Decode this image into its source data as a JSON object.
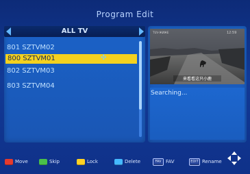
{
  "screen": {
    "title": "Program Edit"
  },
  "list": {
    "header": "ALL TV",
    "channels": [
      {
        "label": "801 SZTVM02",
        "selected": false
      },
      {
        "label": "800 SZTVM01",
        "selected": true
      },
      {
        "label": "802 SZTVM03",
        "selected": false
      },
      {
        "label": "803 SZTVM04",
        "selected": false
      }
    ]
  },
  "preview": {
    "osd_left": "TUV-ЖИЖЕ",
    "osd_right": "12:59",
    "subtitle": "来看看这只小鹿"
  },
  "info": {
    "status": "Searching..."
  },
  "help": [
    {
      "label": "Move",
      "color": "#e53a2d",
      "icon": "red-key"
    },
    {
      "label": "Skip",
      "color": "#4ac04a",
      "icon": "green-key"
    },
    {
      "label": "Lock",
      "color": "#ffd223",
      "icon": "yellow-key"
    },
    {
      "label": "Delete",
      "color": "#45b9ff",
      "icon": "blue-key"
    },
    {
      "label": "FAV",
      "key_text": "FAV",
      "icon": "fav-key"
    },
    {
      "label": "Rename",
      "key_text": "EDIT",
      "icon": "edit-key"
    }
  ],
  "theme": {
    "accent_yellow": "#f4d11f",
    "text_blue": "#bfe0ff"
  }
}
